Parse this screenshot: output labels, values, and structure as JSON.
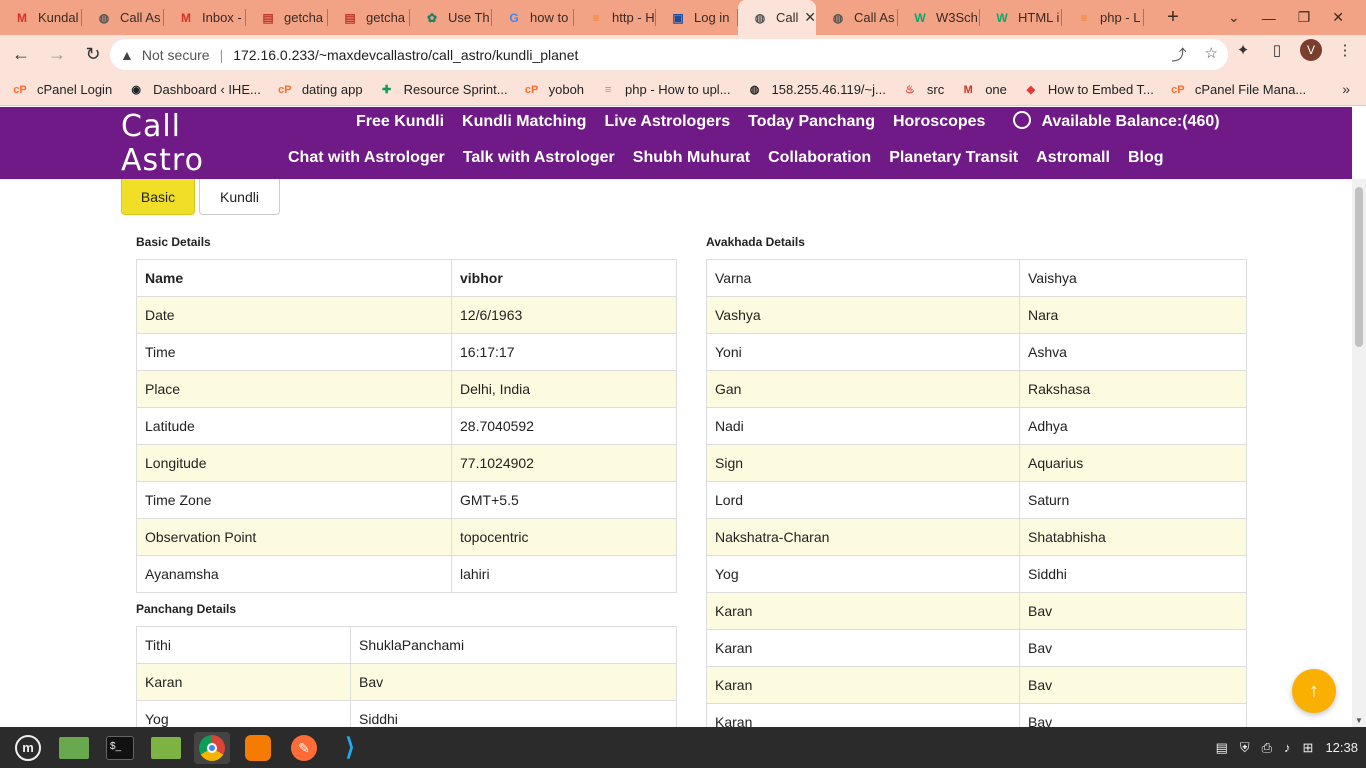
{
  "browser": {
    "tabs": [
      {
        "title": "Kundal",
        "icon": "gmail-icon",
        "color": "#d93025",
        "glyph": "M"
      },
      {
        "title": "Call As",
        "icon": "globe-icon",
        "color": "#555555",
        "glyph": "◍"
      },
      {
        "title": "Inbox -",
        "icon": "gmail-icon",
        "color": "#d93025",
        "glyph": "M"
      },
      {
        "title": "getcha",
        "icon": "sheet-icon",
        "color": "#c0392b",
        "glyph": "▤"
      },
      {
        "title": "getcha",
        "icon": "sheet-icon",
        "color": "#c0392b",
        "glyph": "▤"
      },
      {
        "title": "Use Th",
        "icon": "chatgpt-icon",
        "color": "#1a7f64",
        "glyph": "✿"
      },
      {
        "title": "how to",
        "icon": "google-icon",
        "color": "#4285f4",
        "glyph": "G"
      },
      {
        "title": "http - H",
        "icon": "stackoverflow-icon",
        "color": "#f48024",
        "glyph": "≡"
      },
      {
        "title": "Log in",
        "icon": "site-icon",
        "color": "#1a4fa0",
        "glyph": "▣"
      },
      {
        "title": "Call",
        "icon": "globe-icon",
        "color": "#555555",
        "glyph": "◍",
        "active": true
      },
      {
        "title": "Call As",
        "icon": "globe-icon",
        "color": "#555555",
        "glyph": "◍"
      },
      {
        "title": "W3Sch",
        "icon": "w3schools-icon",
        "color": "#04aa6d",
        "glyph": "W"
      },
      {
        "title": "HTML i",
        "icon": "w3schools-icon",
        "color": "#04aa6d",
        "glyph": "W"
      },
      {
        "title": "php - L",
        "icon": "stackoverflow-icon",
        "color": "#f48024",
        "glyph": "≡"
      }
    ],
    "security": "Not secure",
    "url": "172.16.0.233/~maxdevcallastro/call_astro/kundli_planet",
    "profile_initial": "V",
    "bookmarks": [
      {
        "label": "cPanel Login",
        "glyph": "cP",
        "color": "#ff6c2c"
      },
      {
        "label": "Dashboard ‹ IHE...",
        "glyph": "◉",
        "color": "#222222"
      },
      {
        "label": "dating app",
        "glyph": "cP",
        "color": "#ff6c2c"
      },
      {
        "label": "Resource Sprint...",
        "glyph": "✚",
        "color": "#0f9d58"
      },
      {
        "label": "yoboh",
        "glyph": "cP",
        "color": "#ff6c2c"
      },
      {
        "label": "php - How to upl...",
        "glyph": "≡",
        "color": "#f48024"
      },
      {
        "label": "158.255.46.119/~j...",
        "glyph": "◍",
        "color": "#222222"
      },
      {
        "label": "src",
        "glyph": "♨",
        "color": "#e8453c"
      },
      {
        "label": "one",
        "glyph": "M",
        "color": "#d93025"
      },
      {
        "label": "How to Embed T...",
        "glyph": "◆",
        "color": "#e53935"
      },
      {
        "label": "cPanel File Mana...",
        "glyph": "cP",
        "color": "#ff6c2c"
      }
    ]
  },
  "site": {
    "logo_line1": "Call",
    "logo_line2": "Astro",
    "menu_row1": [
      "Free Kundli",
      "Kundli Matching",
      "Live Astrologers",
      "Today Panchang",
      "Horoscopes"
    ],
    "balance": "Available Balance:(460)",
    "menu_row2": [
      "Chat with Astrologer",
      "Talk with Astrologer",
      "Shubh Muhurat",
      "Collaboration",
      "Planetary Transit",
      "Astromall",
      "Blog"
    ],
    "brand_color": "#6f1a87"
  },
  "tabs_toggle": {
    "basic": "Basic",
    "kundli": "Kundli"
  },
  "basic_details": {
    "title": "Basic Details",
    "rows": [
      [
        "Name",
        "vibhor"
      ],
      [
        "Date",
        "12/6/1963"
      ],
      [
        "Time",
        "16:17:17"
      ],
      [
        "Place",
        "Delhi, India"
      ],
      [
        "Latitude",
        "28.7040592"
      ],
      [
        "Longitude",
        "77.1024902"
      ],
      [
        "Time Zone",
        "GMT+5.5"
      ],
      [
        "Observation Point",
        "topocentric"
      ],
      [
        "Ayanamsha",
        "lahiri"
      ]
    ]
  },
  "panchang_details": {
    "title": "Panchang Details",
    "rows": [
      [
        "Tithi",
        "ShuklaPanchami"
      ],
      [
        "Karan",
        "Bav"
      ],
      [
        "Yog",
        "Siddhi"
      ]
    ]
  },
  "avakhada_details": {
    "title": "Avakhada Details",
    "rows": [
      [
        "Varna",
        "Vaishya"
      ],
      [
        "Vashya",
        "Nara"
      ],
      [
        "Yoni",
        "Ashva"
      ],
      [
        "Gan",
        "Rakshasa"
      ],
      [
        "Nadi",
        "Adhya"
      ],
      [
        "Sign",
        "Aquarius"
      ],
      [
        "Lord",
        "Saturn"
      ],
      [
        "Nakshatra-Charan",
        "Shatabhisha"
      ],
      [
        "Yog",
        "Siddhi"
      ],
      [
        "Karan",
        "Bav"
      ],
      [
        "Karan",
        "Bav"
      ],
      [
        "Karan",
        "Bav"
      ],
      [
        "Karan",
        "Bav"
      ]
    ]
  },
  "taskbar": {
    "clock": "12:38"
  }
}
